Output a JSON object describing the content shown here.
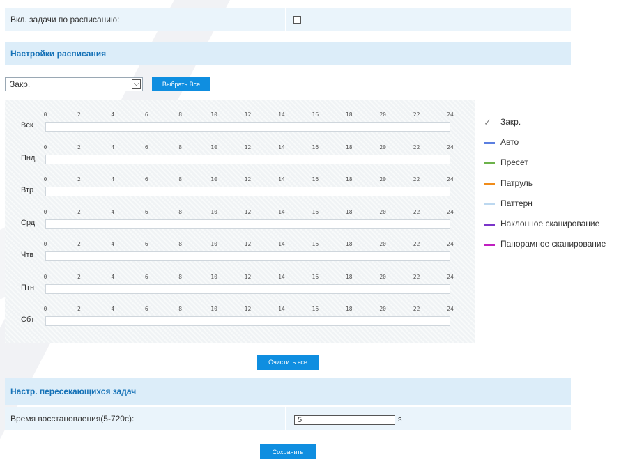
{
  "schedule_enable": {
    "label": "Вкл. задачи по расписанию:",
    "checked": false
  },
  "schedule_settings": {
    "title": "Настройки расписания",
    "mode_select": {
      "selected": "Закр."
    },
    "select_all_label": "Выбрать Все",
    "days": [
      "Вск",
      "Пнд",
      "Втр",
      "Срд",
      "Чтв",
      "Птн",
      "Сбт"
    ],
    "hours": [
      "0",
      "2",
      "4",
      "6",
      "8",
      "10",
      "12",
      "14",
      "16",
      "18",
      "20",
      "22",
      "24"
    ],
    "clear_all_label": "Очистить все"
  },
  "legend": [
    {
      "label": "Закр.",
      "color": "#808080",
      "icon": "eraser-icon"
    },
    {
      "label": "Авто",
      "color": "#5b7fe0"
    },
    {
      "label": "Пресет",
      "color": "#6cb24a"
    },
    {
      "label": "Патруль",
      "color": "#f08c1a"
    },
    {
      "label": "Паттерн",
      "color": "#bcd8f0"
    },
    {
      "label": "Наклонное сканирование",
      "color": "#7b35c9"
    },
    {
      "label": "Панорамное сканирование",
      "color": "#c020c0"
    }
  ],
  "overlap_settings": {
    "title": "Настр. пересекающихся задач",
    "recovery_label": "Время восстановления(5-720с):",
    "recovery_value": "5",
    "recovery_unit": "s"
  },
  "save_label": "Сохранить",
  "colors": {
    "accent": "#0f8ee0",
    "section_bg": "#dcedf9",
    "row_bg": "#eaf4fb",
    "title": "#1672b7"
  }
}
